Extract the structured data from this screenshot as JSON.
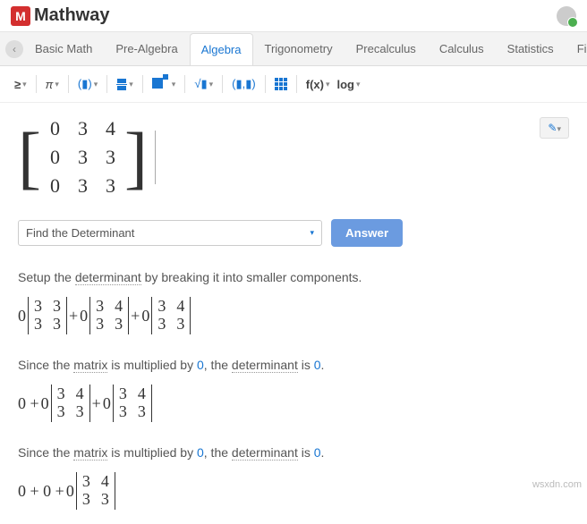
{
  "brand": {
    "name": "Mathway"
  },
  "tabs": {
    "items": [
      "Basic Math",
      "Pre-Algebra",
      "Algebra",
      "Trigonometry",
      "Precalculus",
      "Calculus",
      "Statistics",
      "Finite Math"
    ],
    "active": "Algebra"
  },
  "toolbar": {
    "ge": "≥",
    "pi": "π",
    "paren": "(▮)",
    "sqrt": "√▮",
    "coord": "(▮,▮)",
    "fx": "f(x)",
    "log": "log"
  },
  "editor": {
    "pencil": "✎",
    "dropdown_caret": "▾"
  },
  "matrix": {
    "rows": [
      [
        "0",
        "3",
        "4"
      ],
      [
        "0",
        "3",
        "3"
      ],
      [
        "0",
        "3",
        "3"
      ]
    ]
  },
  "operation": {
    "selected": "Find the Determinant",
    "answer_btn": "Answer"
  },
  "solution": {
    "step1_a": "Setup the ",
    "step1_b": "determinant",
    "step1_c": " by breaking it into smaller components.",
    "step2_a": "Since the ",
    "step2_b": "matrix",
    "step2_c": " is multiplied by ",
    "step2_d": "0",
    "step2_e": ", the ",
    "step2_f": "determinant",
    "step2_g": " is ",
    "step2_h": "0",
    "step2_i": ".",
    "step3_a": "Since the ",
    "step3_b": "matrix",
    "step3_c": " is multiplied by ",
    "step3_d": "0",
    "step3_e": ", the ",
    "step3_f": "determinant",
    "step3_g": " is ",
    "step3_h": "0",
    "step3_i": "."
  },
  "math": {
    "line1": {
      "c0": "0",
      "m0": [
        "3",
        "3",
        "3",
        "3"
      ],
      "p1": " + ",
      "c1": "0",
      "m1": [
        "3",
        "4",
        "3",
        "3"
      ],
      "p2": " + ",
      "c2": "0",
      "m2": [
        "3",
        "4",
        "3",
        "3"
      ]
    },
    "line2": {
      "t0": "0 + ",
      "c1": "0",
      "m1": [
        "3",
        "4",
        "3",
        "3"
      ],
      "p2": " + ",
      "c2": "0",
      "m2": [
        "3",
        "4",
        "3",
        "3"
      ]
    },
    "line3": {
      "t0": "0 + 0 + ",
      "c2": "0",
      "m2": [
        "3",
        "4",
        "3",
        "3"
      ]
    }
  },
  "watermark": "wsxdn.com"
}
